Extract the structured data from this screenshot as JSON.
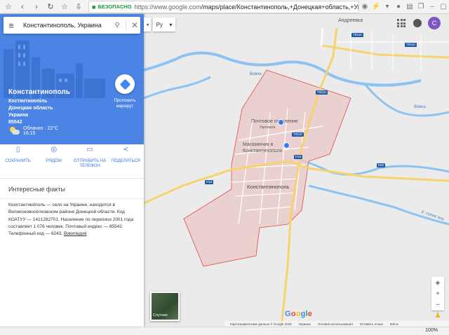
{
  "browser": {
    "secure_label": "БЕЗОПАСНО",
    "url_prefix": "https://www.google.com",
    "url_path": "/maps/place/Константинополь,+Донецкая+область,+Украина,+"
  },
  "search": {
    "value": "Константинополь, Украина"
  },
  "place": {
    "title": "Константинополь",
    "lines": [
      "Костянтинопіль",
      "Донецкая область",
      "Украина",
      "85542"
    ],
    "weather": "Облачно · 22°C",
    "time": "16:15",
    "route_label": "Проложить маршрут"
  },
  "actions": [
    {
      "label": "СОХРАНИТЬ",
      "icon": "bookmark-icon"
    },
    {
      "label": "РЯДОМ",
      "icon": "nearby-icon"
    },
    {
      "label": "ОТПРАВИТЬ НА ТЕЛЕФОН",
      "icon": "phone-icon"
    },
    {
      "label": "ПОДЕЛИТЬСЯ",
      "icon": "share-icon"
    }
  ],
  "facts": {
    "title": "Интересные факты",
    "text": "Константино́поль — село на Украине, находится в Великоновосёлковском районе Донецкой области. Код КОАТУУ — 1421282701. Население по переписи 2001 года составляет 1 076 человек. Почтовый индекс — 85542. Телефонный код — 6243.",
    "link": "Википедия"
  },
  "map": {
    "lang_button": "Ру",
    "avatar_letter": "С",
    "labels": {
      "andreevka": "Андреевка",
      "vovcha": "Вовча",
      "vovcha_right": "Вовча",
      "post": "Почтовое отделение",
      "post_sub": "Укрпошта",
      "shop_1": "Магазинчик в",
      "shop_2": "Константинополе",
      "village": "Константинополь",
      "river_lower": "р. сухие яль"
    },
    "road_badges": [
      "T0515",
      "T0515",
      "T0515",
      "T0515",
      "H15",
      "H15",
      "E50"
    ],
    "satellite_label": "Спутник",
    "google": [
      "G",
      "o",
      "o",
      "g",
      "l",
      "e"
    ],
    "footer": [
      "Картографические данные © Google 2018",
      "Украина",
      "Условия использования",
      "Оставить отзыв",
      "500 м"
    ],
    "zoom_level": "100%",
    "colors": {
      "boundary": "#e24a4a",
      "panel_blue": "#4b84e4",
      "road": "#f6d36f",
      "water": "#8ec3f0"
    }
  }
}
